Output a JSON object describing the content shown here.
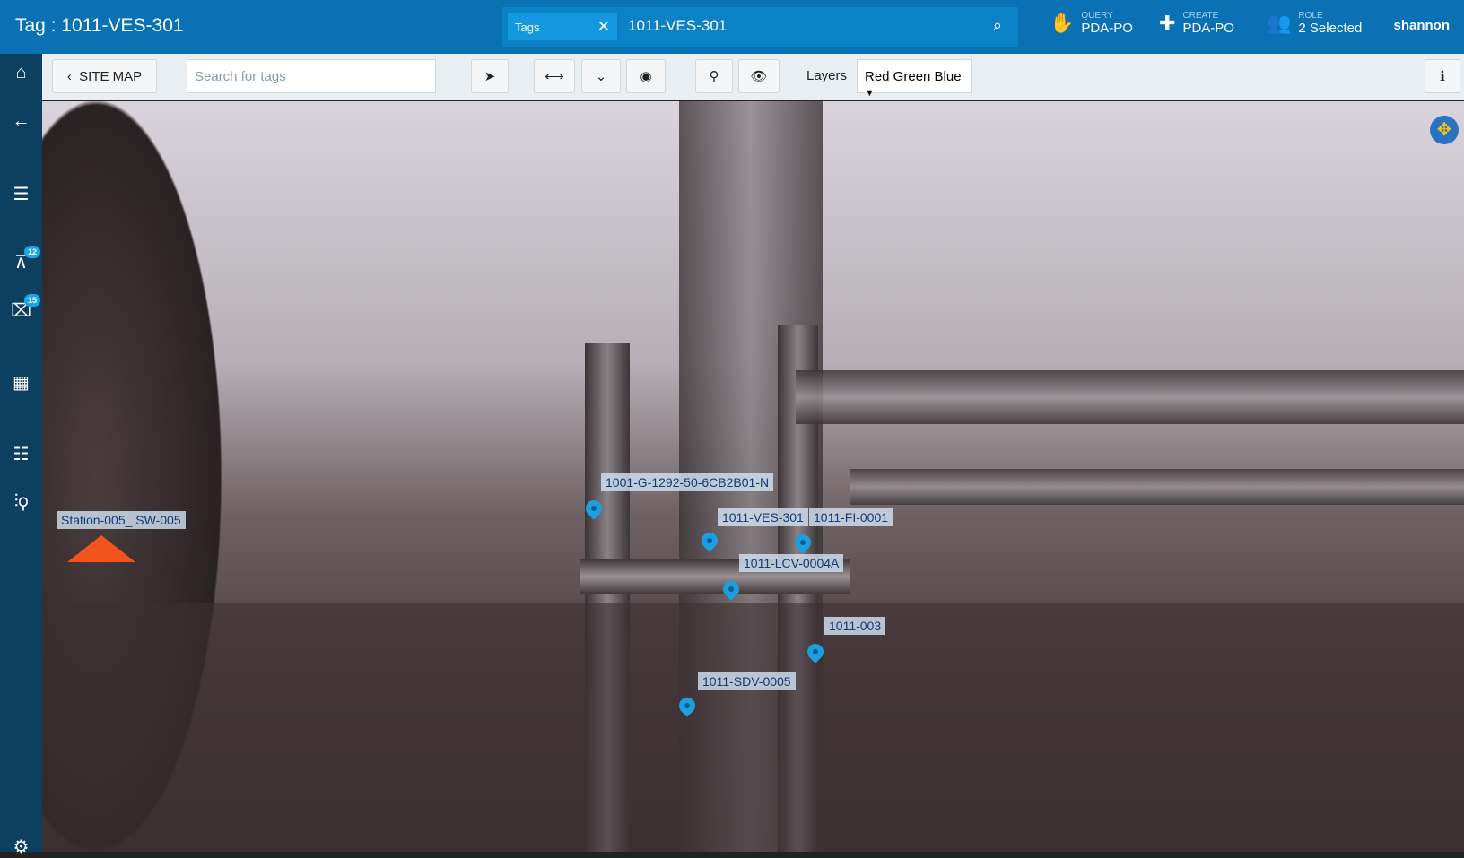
{
  "header": {
    "title": "Tag : 1011-VES-301",
    "search": {
      "chip": "Tags",
      "value": "1011-VES-301"
    },
    "query": {
      "small": "QUERY",
      "label": "PDA-PO"
    },
    "create": {
      "small": "CREATE",
      "label": "PDA-PO"
    },
    "role": {
      "small": "ROLE",
      "label": "2 Selected"
    },
    "user": "shannon"
  },
  "sidebar": {
    "items": [
      {
        "icon": "home-icon"
      },
      {
        "icon": "back-arrow-icon"
      },
      {
        "icon": "list-icon"
      },
      {
        "icon": "pin-icon",
        "badge": "12"
      },
      {
        "icon": "inbox-icon",
        "badge": "15"
      },
      {
        "icon": "grid-icon"
      },
      {
        "icon": "numbered-list-icon"
      },
      {
        "icon": "analytics-search-icon"
      },
      {
        "icon": "settings-icon"
      }
    ]
  },
  "toolbar": {
    "site_map": "SITE MAP",
    "search_placeholder": "Search for tags",
    "layers_label": "Layers",
    "layers_value": "Red Green Blue"
  },
  "tags": [
    "1001-G-1292-50-6CB2B01-N",
    "1011-VES-301",
    "1011-FI-0001",
    "1011-LCV-0004A",
    "1011-003",
    "1011-SDV-0005",
    "Station-005_ SW-005"
  ],
  "colors": {
    "header": "#0a71b4",
    "sidebar": "#0d3f60",
    "pin": "#1c9ee0",
    "tag_text": "#113c78"
  }
}
